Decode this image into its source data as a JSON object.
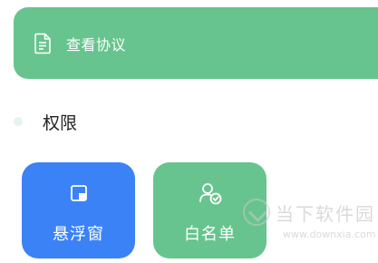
{
  "agreement": {
    "label": "查看协议",
    "icon": "document-icon"
  },
  "permissions": {
    "title": "权限",
    "tiles": [
      {
        "label": "悬浮窗",
        "icon": "floating-window-icon",
        "color": "#3b82f6"
      },
      {
        "label": "白名单",
        "icon": "user-check-icon",
        "color": "#67c48e"
      }
    ]
  },
  "watermark": {
    "name": "当下软件园",
    "url": "www.downxia.com"
  },
  "colors": {
    "green": "#67c48e",
    "blue": "#3b82f6"
  }
}
